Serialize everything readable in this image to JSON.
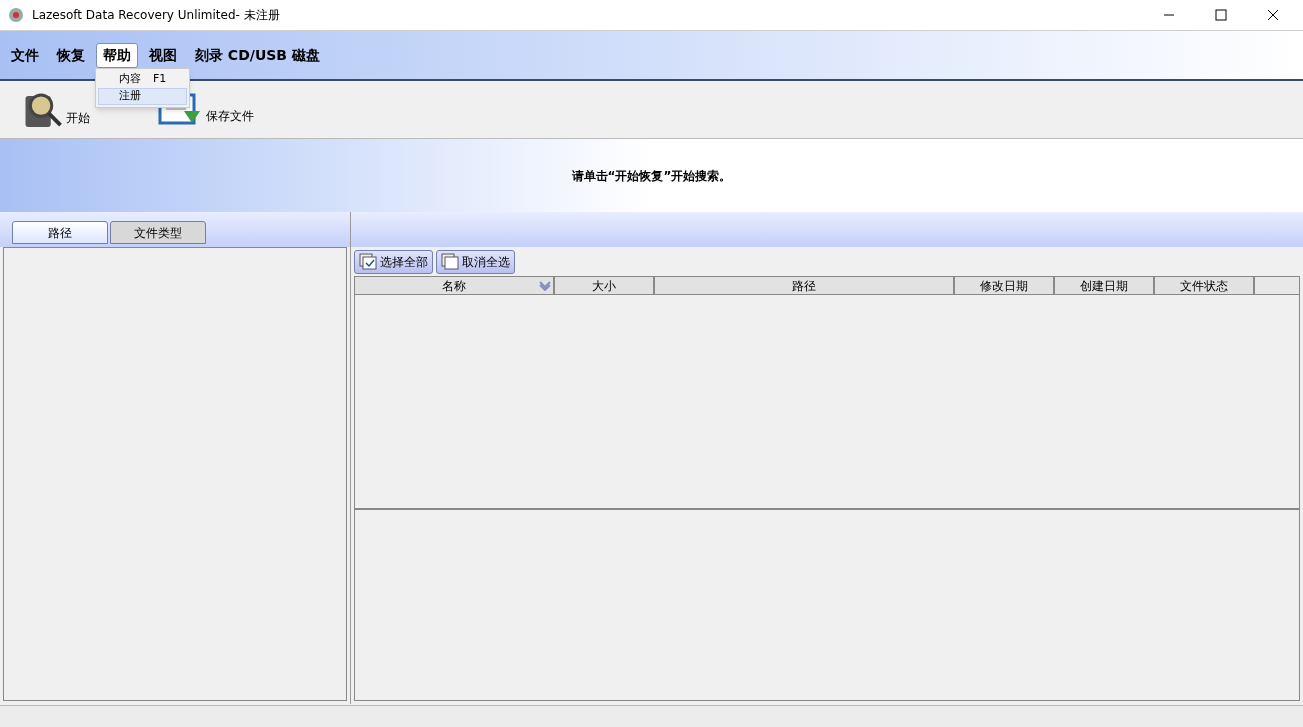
{
  "window": {
    "title": "Lazesoft Data Recovery Unlimited- 未注册"
  },
  "menu": [
    {
      "label": "文件",
      "selected": false
    },
    {
      "label": "恢复",
      "selected": false
    },
    {
      "label": "帮助",
      "selected": true
    },
    {
      "label": "视图",
      "selected": false
    },
    {
      "label": "刻录 CD/USB 磁盘",
      "selected": false
    }
  ],
  "dropdown": [
    {
      "label": "内容",
      "shortcut": "F1",
      "selected": false
    },
    {
      "label": "注册",
      "selected": true
    }
  ],
  "toolbar": [
    {
      "kind": "recover",
      "label": "开始"
    },
    {
      "kind": "save",
      "label": "保存文件"
    }
  ],
  "banner": {
    "message": "请单击“开始恢复”开始搜索。"
  },
  "tabs": [
    {
      "label": "路径",
      "selected": true
    },
    {
      "label": "文件类型",
      "selected": false
    }
  ],
  "selection_buttons": [
    {
      "kind": "check",
      "label": "选择全部"
    },
    {
      "kind": "uncheck",
      "label": "取消全选"
    }
  ],
  "table": {
    "columns": [
      {
        "label": "名称",
        "sorted": true
      },
      {
        "label": "大小",
        "sorted": false
      },
      {
        "label": "路径",
        "sorted": false
      },
      {
        "label": "修改日期",
        "sorted": false
      },
      {
        "label": "创建日期",
        "sorted": false
      },
      {
        "label": "文件状态",
        "sorted": false
      }
    ]
  }
}
